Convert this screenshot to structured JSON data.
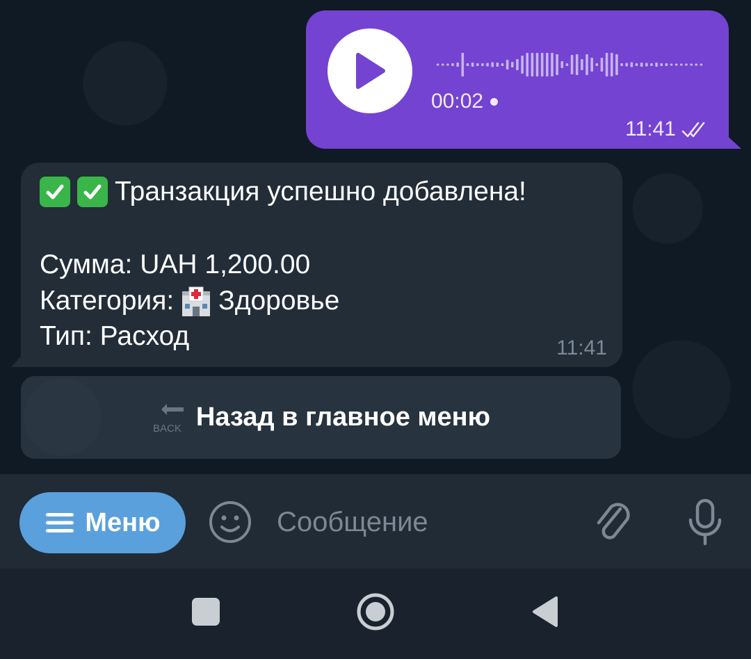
{
  "voice_message": {
    "duration": "00:02",
    "time": "11:41",
    "status": "read",
    "waveform": [
      3,
      3,
      3,
      4,
      6,
      34,
      4,
      6,
      4,
      4,
      5,
      7,
      6,
      4,
      14,
      8,
      16,
      26,
      34,
      34,
      34,
      34,
      34,
      34,
      30,
      10,
      4,
      28,
      30,
      16,
      30,
      20,
      4,
      20,
      34,
      34,
      30,
      4,
      5,
      7,
      4,
      6,
      5,
      4,
      6,
      4,
      4,
      3,
      3,
      3,
      3,
      3,
      3,
      3
    ],
    "bubble_color": "#7443d2",
    "wave_color": "#c7b4f0"
  },
  "bot_message": {
    "title": "Транзакция успешно добавлена!",
    "amount_line": "Сумма: UAH 1,200.00",
    "category_prefix": "Категория:",
    "category_name": "Здоровье",
    "type_line": "Тип: Расход",
    "time": "11:41",
    "title_icons": [
      "check-mark-icon",
      "check-mark-icon"
    ],
    "category_icon": "hospital-icon"
  },
  "inline_keyboard": {
    "back_button_label": "Назад в главное меню",
    "back_icon_text": "BACK"
  },
  "input_bar": {
    "menu_label": "Меню",
    "placeholder": "Сообщение",
    "accent_color": "#5aa0dc"
  }
}
